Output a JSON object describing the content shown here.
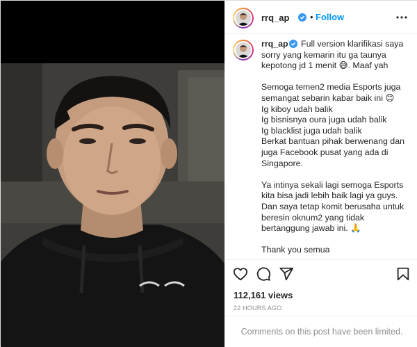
{
  "post": {
    "username": "rrq_ap",
    "verified": true,
    "follow_label": "Follow",
    "separator": "•"
  },
  "caption": {
    "username": "rrq_ap",
    "lines": [
      "Full version klarifikasi saya sorry yang kemarin itu ga taunya kepotong jd 1 menit 😅. Maaf yah",
      "",
      "Semoga temen2 media Esports juga semangat sebarin kabar baik ini 😊",
      "Ig kiboy udah balik",
      "Ig bisnisnya oura juga udah balik",
      "Ig blacklist juga udah balik",
      "Berkat bantuan pihak berwenang dan juga Facebook pusat yang ada di Singapore.",
      "",
      "Ya intinya sekali lagi semoga Esports kita bisa jadi lebih baik lagi ya guys. Dan saya tetap komit berusaha untuk beresin oknum2 yang tidak bertanggung jawab ini. 🙏",
      "",
      "Thank you semua"
    ]
  },
  "stats": {
    "views": "112,161 views",
    "time": "22 HOURS AGO"
  },
  "comments_notice": "Comments on this post have been limited.",
  "icons": {
    "like": "heart-icon",
    "comment": "comment-icon",
    "share": "share-icon",
    "save": "bookmark-icon",
    "more": "more-options-icon",
    "verified": "verified-badge-icon"
  },
  "colors": {
    "accent": "#0095f6",
    "verified": "#3897f0",
    "muted": "#8e8e8e",
    "text": "#262626"
  }
}
